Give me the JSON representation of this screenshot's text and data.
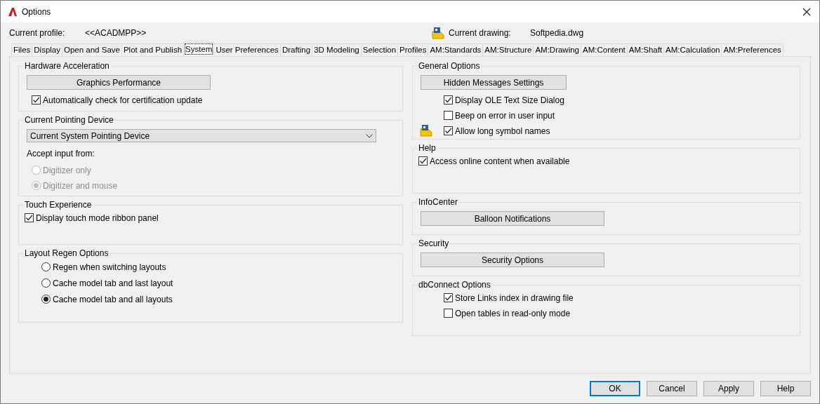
{
  "window": {
    "title": "Options"
  },
  "profile": {
    "label": "Current profile:",
    "value": "<<ACADMPP>>"
  },
  "drawing": {
    "label": "Current drawing:",
    "value": "Softpedia.dwg"
  },
  "tabs": [
    {
      "label": "Files",
      "selected": false
    },
    {
      "label": "Display",
      "selected": false
    },
    {
      "label": "Open and Save",
      "selected": false
    },
    {
      "label": "Plot and Publish",
      "selected": false
    },
    {
      "label": "System",
      "selected": true
    },
    {
      "label": "User Preferences",
      "selected": false
    },
    {
      "label": "Drafting",
      "selected": false
    },
    {
      "label": "3D Modeling",
      "selected": false
    },
    {
      "label": "Selection",
      "selected": false
    },
    {
      "label": "Profiles",
      "selected": false
    },
    {
      "label": "AM:Standards",
      "selected": false
    },
    {
      "label": "AM:Structure",
      "selected": false
    },
    {
      "label": "AM:Drawing",
      "selected": false
    },
    {
      "label": "AM:Content",
      "selected": false
    },
    {
      "label": "AM:Shaft",
      "selected": false
    },
    {
      "label": "AM:Calculation",
      "selected": false
    },
    {
      "label": "AM:Preferences",
      "selected": false
    }
  ],
  "left_groups": [
    {
      "title": "Hardware Acceleration",
      "items": [
        {
          "kind": "button",
          "label": "Graphics Performance"
        },
        {
          "kind": "checkbox",
          "label": "Automatically check for certification update",
          "checked": true
        }
      ]
    },
    {
      "title": "Current Pointing Device",
      "items": [
        {
          "kind": "dropdown",
          "value": "Current System Pointing Device"
        },
        {
          "kind": "text",
          "label": "Accept input from:"
        },
        {
          "kind": "radio",
          "label": "Digitizer only",
          "selected": false,
          "disabled": true
        },
        {
          "kind": "radio",
          "label": "Digitizer and mouse",
          "selected": true,
          "disabled": true
        }
      ]
    },
    {
      "title": "Touch Experience",
      "items": [
        {
          "kind": "checkbox",
          "label": "Display touch mode ribbon panel",
          "checked": true
        }
      ]
    },
    {
      "title": "Layout Regen Options",
      "items": [
        {
          "kind": "radio",
          "label": "Regen when switching layouts",
          "selected": false,
          "disabled": false
        },
        {
          "kind": "radio",
          "label": "Cache model tab and last layout",
          "selected": false,
          "disabled": false
        },
        {
          "kind": "radio",
          "label": "Cache model tab and all layouts",
          "selected": true,
          "disabled": false
        }
      ]
    }
  ],
  "right_groups": [
    {
      "title": "General Options",
      "items": [
        {
          "kind": "button",
          "label": "Hidden Messages Settings"
        },
        {
          "kind": "checkbox",
          "label": "Display OLE Text Size Dialog",
          "checked": true,
          "saved_in_drawing": false
        },
        {
          "kind": "checkbox",
          "label": "Beep on error in user input",
          "checked": false,
          "saved_in_drawing": false
        },
        {
          "kind": "checkbox",
          "label": "Allow long symbol names",
          "checked": true,
          "saved_in_drawing": true
        }
      ]
    },
    {
      "title": "Help",
      "items": [
        {
          "kind": "checkbox",
          "label": "Access online content when available",
          "checked": true
        }
      ]
    },
    {
      "title": "InfoCenter",
      "items": [
        {
          "kind": "button",
          "label": "Balloon Notifications"
        }
      ]
    },
    {
      "title": "Security",
      "items": [
        {
          "kind": "button",
          "label": "Security Options"
        }
      ]
    },
    {
      "title": "dbConnect Options",
      "items": [
        {
          "kind": "checkbox",
          "label": "Store Links index in drawing file",
          "checked": true
        },
        {
          "kind": "checkbox",
          "label": "Open tables in read-only mode",
          "checked": false
        }
      ]
    }
  ],
  "buttons": [
    {
      "label": "OK",
      "default": true
    },
    {
      "label": "Cancel",
      "default": false
    },
    {
      "label": "Apply",
      "default": false
    },
    {
      "label": "Help",
      "default": false
    }
  ]
}
